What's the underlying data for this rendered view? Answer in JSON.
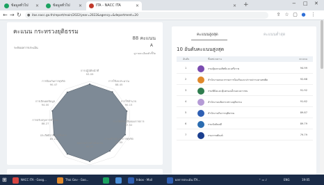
{
  "browser": {
    "tabs": [
      {
        "label": "ข้อมูลทั่วไป",
        "color": "#1aa260"
      },
      {
        "label": "ข้อมูลทั่วไป",
        "color": "#1aa260"
      },
      {
        "label": "ITA - NACC ITA",
        "color": "#c0392b"
      }
    ],
    "new_tab": "+",
    "url": "itas.nacc.go.th/report/main/2022/year=2022&agency=&department=20",
    "window_controls": [
      "−",
      "□",
      "✕"
    ]
  },
  "left_panel": {
    "title": "คะแนน กระทรวงยุติธรรม",
    "score": "88 คะแนน",
    "grade": "A",
    "subtitle": "ระดับผลการประเมิน",
    "note": "ดูรายละเอียดตัวชี้วัด",
    "radar_labels": [
      {
        "name": "การปฏิบัติหน้าที่",
        "value": "93.09"
      },
      {
        "name": "การใช้งบประมาณ",
        "value": "88.45"
      },
      {
        "name": "การใช้อำนาจ",
        "value": "90.15"
      },
      {
        "name": "การใช้ทรัพย์สินของราชการ",
        "value": "87.52"
      },
      {
        "name": "การแก้ไขปัญหาการทุจริต",
        "value": "82.55"
      },
      {
        "name": "คุณภาพการดำเนินงาน",
        "value": "90.53"
      },
      {
        "name": "ประสิทธิภาพการสื่อสาร",
        "value": "85.21"
      },
      {
        "name": "การปรับปรุงการทำงาน",
        "value": "88.27"
      },
      {
        "name": "การเปิดเผยข้อมูล",
        "value": "94.00"
      },
      {
        "name": "การป้องกันการทุจริต",
        "value": "90.47"
      }
    ]
  },
  "right_panel": {
    "tab_active": "คะแนนสูงสุด",
    "tab_inactive": "คะแนนต่ำสุด",
    "heading": "10 อันดับคะแนนสูงสุด",
    "columns": [
      "อันดับ",
      "ชื่อหน่วยงาน",
      "คะแนน"
    ],
    "rows": [
      {
        "rank": "1",
        "name": "กรมคุ้มครองสิทธิและเสรีภาพ",
        "score": "94.99",
        "logo_color": "#7b4cb0"
      },
      {
        "rank": "2",
        "name": "สำนักงานคณะกรรมการป้องกันและปราบปรามยาเสพติด",
        "score": "92.88",
        "logo_color": "#e0892b"
      },
      {
        "rank": "3",
        "name": "กรมพินิจและคุ้มครองเด็กและเยาวชน",
        "score": "91.92",
        "logo_color": "#2f7d4f"
      },
      {
        "rank": "4",
        "name": "สำนักงานปลัดกระทรวงยุติธรรม",
        "score": "91.62",
        "logo_color": "#b59bd6"
      },
      {
        "rank": "5",
        "name": "สำนักงานกิจการยุติธรรม",
        "score": "89.87",
        "logo_color": "#2f5fb3"
      },
      {
        "rank": "6",
        "name": "กรมบังคับคดี",
        "score": "89.79",
        "logo_color": "#2b6cb0"
      },
      {
        "rank": "7",
        "name": "กรมราชทัณฑ์",
        "score": "79.79",
        "logo_color": "#1b3f8f"
      }
    ]
  },
  "taskbar": {
    "items": [
      {
        "label": "NACC ITA - Goog...",
        "color": "#d64541"
      },
      {
        "label": "Thai Gov - Goo...",
        "color": "#e0892b"
      },
      {
        "label": "",
        "color": "#1aa260"
      },
      {
        "label": "",
        "color": "#4a90d9"
      },
      {
        "label": "Inbox - Mail",
        "color": "#2f5fb3"
      },
      {
        "label": "ผลการประเมิน ITA...",
        "color": "#2f5fb3"
      }
    ],
    "tray": "ENG",
    "time": "19:05"
  }
}
